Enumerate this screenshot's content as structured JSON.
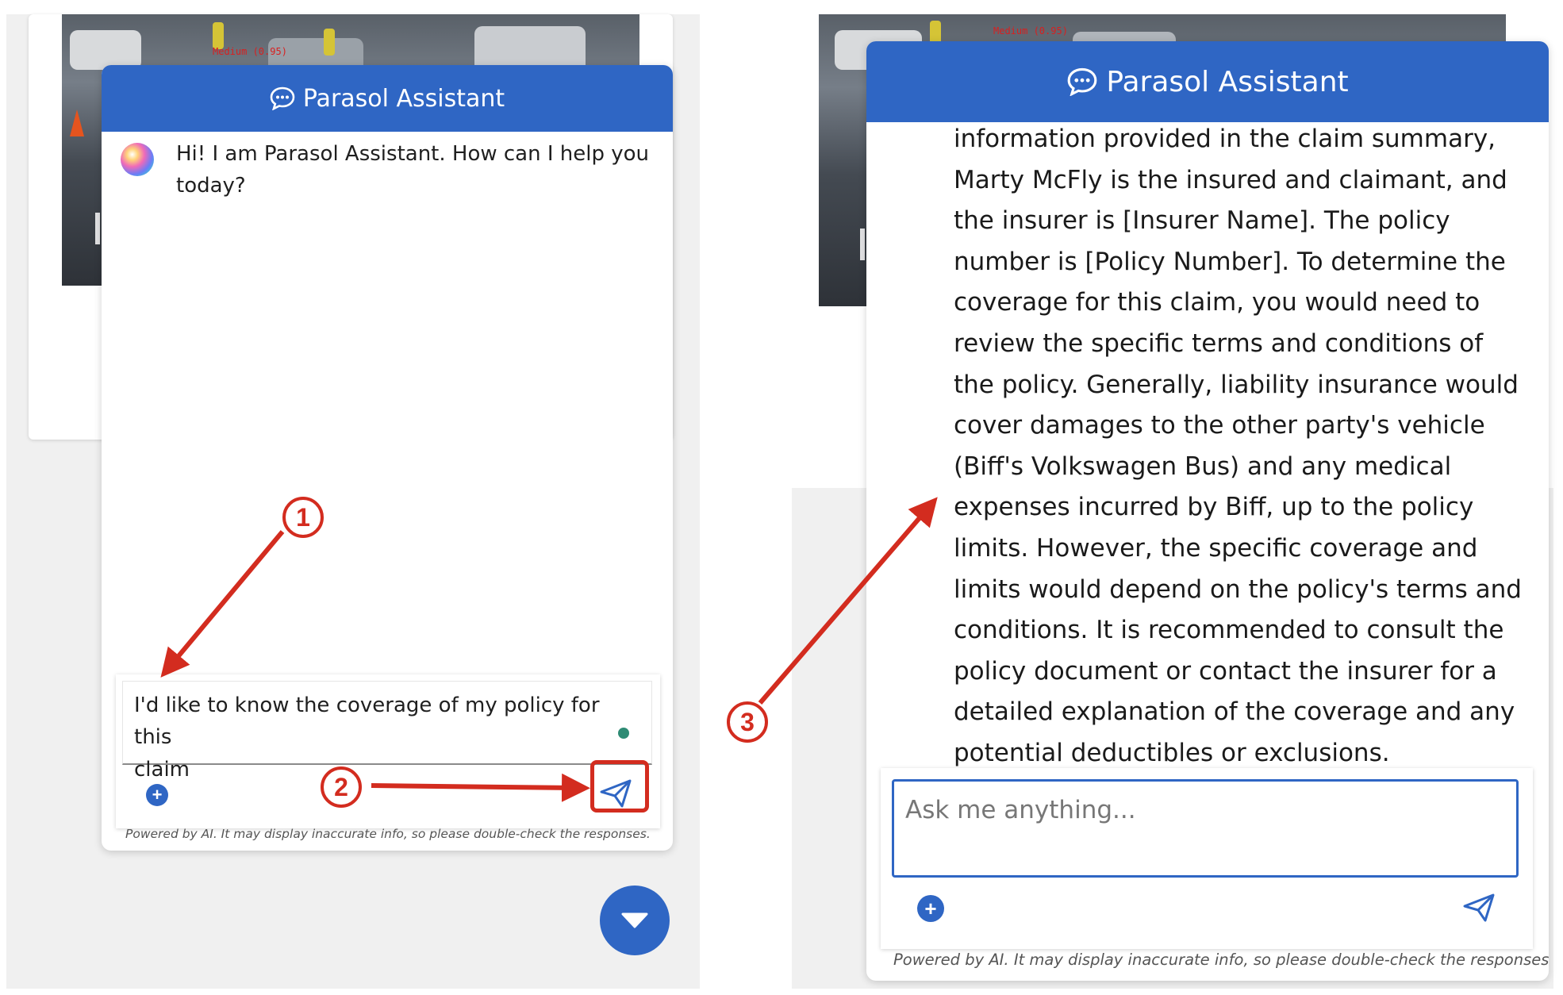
{
  "left": {
    "header": {
      "title": "Parasol Assistant"
    },
    "bot_message": [
      "Hi! I am Parasol Assistant. How can I help you",
      "today?"
    ],
    "input_value": [
      "I'd like to know the coverage of my policy for this",
      "claim"
    ],
    "disclaimer": "Powered by AI. It may display inaccurate info, so please double-check the responses."
  },
  "right": {
    "header": {
      "title": "Parasol Assistant"
    },
    "answer_lines": [
      "information provided in the claim summary,",
      "Marty McFly is the insured and claimant, and",
      "the insurer is [Insurer Name]. The policy",
      "number is [Policy Number]. To determine the",
      "coverage for this claim, you would need to",
      "review the specific terms and conditions of",
      "the policy. Generally, liability insurance would",
      "cover damages to the other party's vehicle",
      "(Biff's Volkswagen Bus) and any medical",
      "expenses incurred by Biff, up to the policy",
      "limits. However, the specific coverage and",
      "limits would depend on the policy's terms and",
      "conditions. It is recommended to consult the",
      "policy document or contact the insurer for a",
      "detailed explanation of the coverage and any",
      "potential deductibles or exclusions."
    ],
    "input_placeholder": "Ask me anything...",
    "disclaimer": "Powered by AI. It may display inaccurate info, so please double-check the responses."
  },
  "photo_overlay_text": "Medium (0.95)",
  "annotations": {
    "step1": "1",
    "step2": "2",
    "step3": "3"
  },
  "icons": {
    "chat": "chat-bubble-icon",
    "add": "plus-circle-icon",
    "send": "paper-plane-icon",
    "scroll_down": "caret-down-icon"
  },
  "colors": {
    "brand_blue": "#2f66c4",
    "annotation_red": "#d32c1f",
    "status_dot": "#2e8b74"
  }
}
